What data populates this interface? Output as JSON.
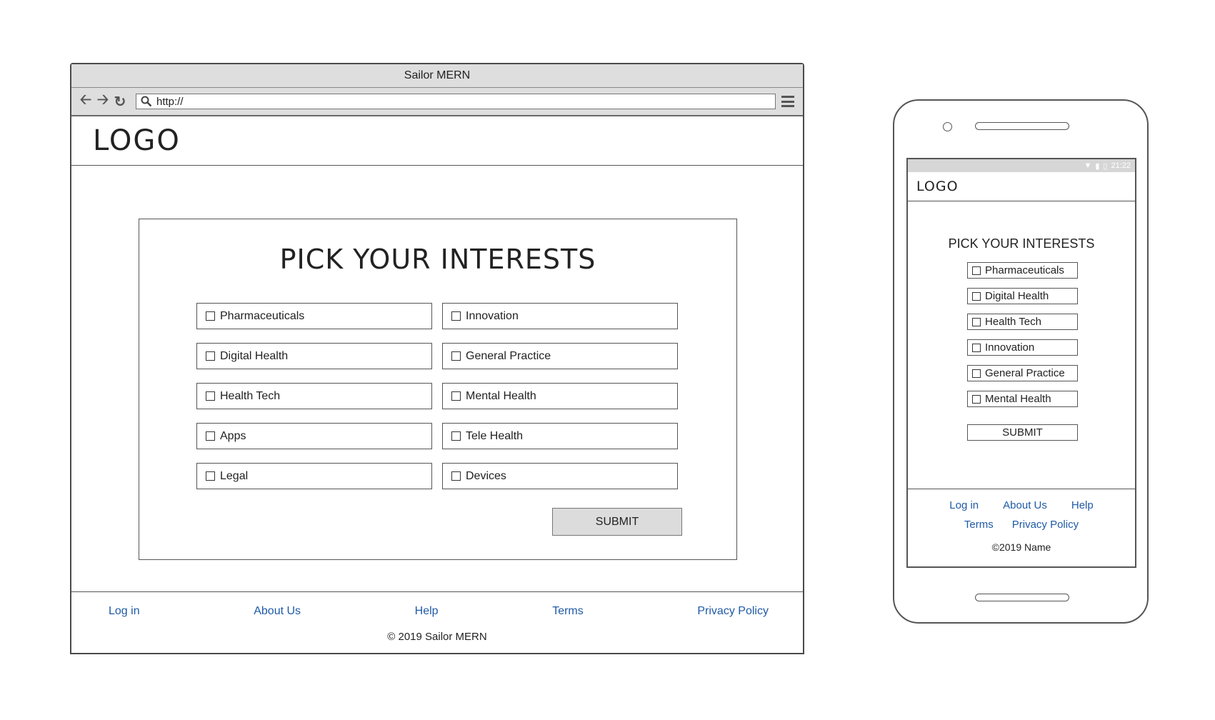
{
  "browser": {
    "title": "Sailor MERN",
    "url": "http://"
  },
  "desktop": {
    "logo": "LOGO",
    "heading": "PICK YOUR INTERESTS",
    "options": [
      "Pharmaceuticals",
      "Innovation",
      "Digital Health",
      "General Practice",
      "Health Tech",
      "Mental Health",
      "Apps",
      "Tele Health",
      "Legal",
      "Devices"
    ],
    "submit": "SUBMIT",
    "footer": {
      "links": [
        "Log in",
        "About Us",
        "Help",
        "Terms",
        "Privacy Policy"
      ],
      "copyright": "© 2019 Sailor MERN"
    }
  },
  "mobile": {
    "status_time": "21:22",
    "logo": "LOGO",
    "heading": "PICK YOUR INTERESTS",
    "options": [
      "Pharmaceuticals",
      "Digital Health",
      "Health Tech",
      "Innovation",
      "General Practice",
      "Mental Health"
    ],
    "submit": "SUBMIT",
    "footer": {
      "links_row1": [
        "Log in",
        "About Us",
        "Help"
      ],
      "links_row2": [
        "Terms",
        "Privacy Policy"
      ],
      "copyright": "©2019 Name"
    }
  },
  "colors": {
    "link": "#1f5aa6",
    "chrome": "#dedede",
    "submit_bg": "#dcdcdc"
  }
}
